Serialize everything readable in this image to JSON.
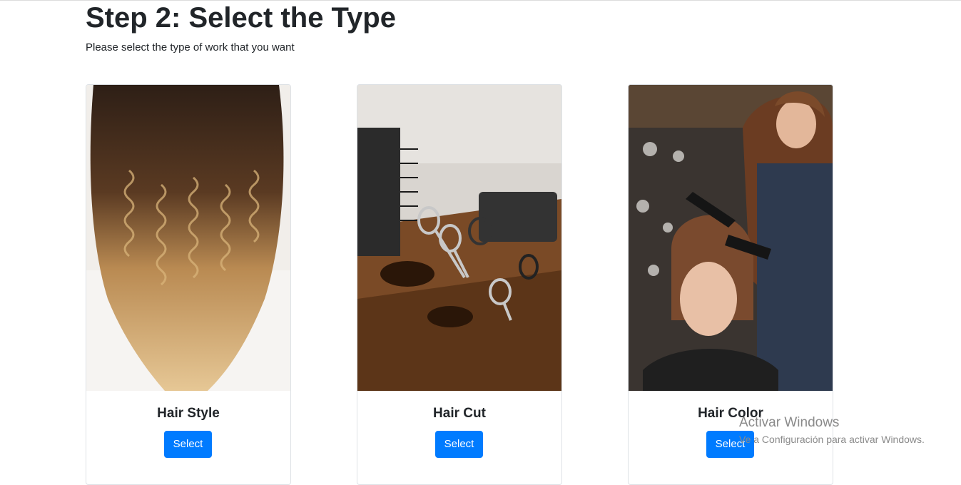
{
  "header": {
    "title": "Step 2: Select the Type",
    "subtitle": "Please select the type of work that you want"
  },
  "cards": [
    {
      "title": "Hair Style",
      "button_label": "Select"
    },
    {
      "title": "Hair Cut",
      "button_label": "Select"
    },
    {
      "title": "Hair Color",
      "button_label": "Select"
    }
  ],
  "watermark": {
    "title": "Activar Windows",
    "subtitle": "Ve a Configuración para activar Windows."
  },
  "colors": {
    "button": "#007bff",
    "text": "#212529",
    "card_border": "#dee2e6"
  }
}
